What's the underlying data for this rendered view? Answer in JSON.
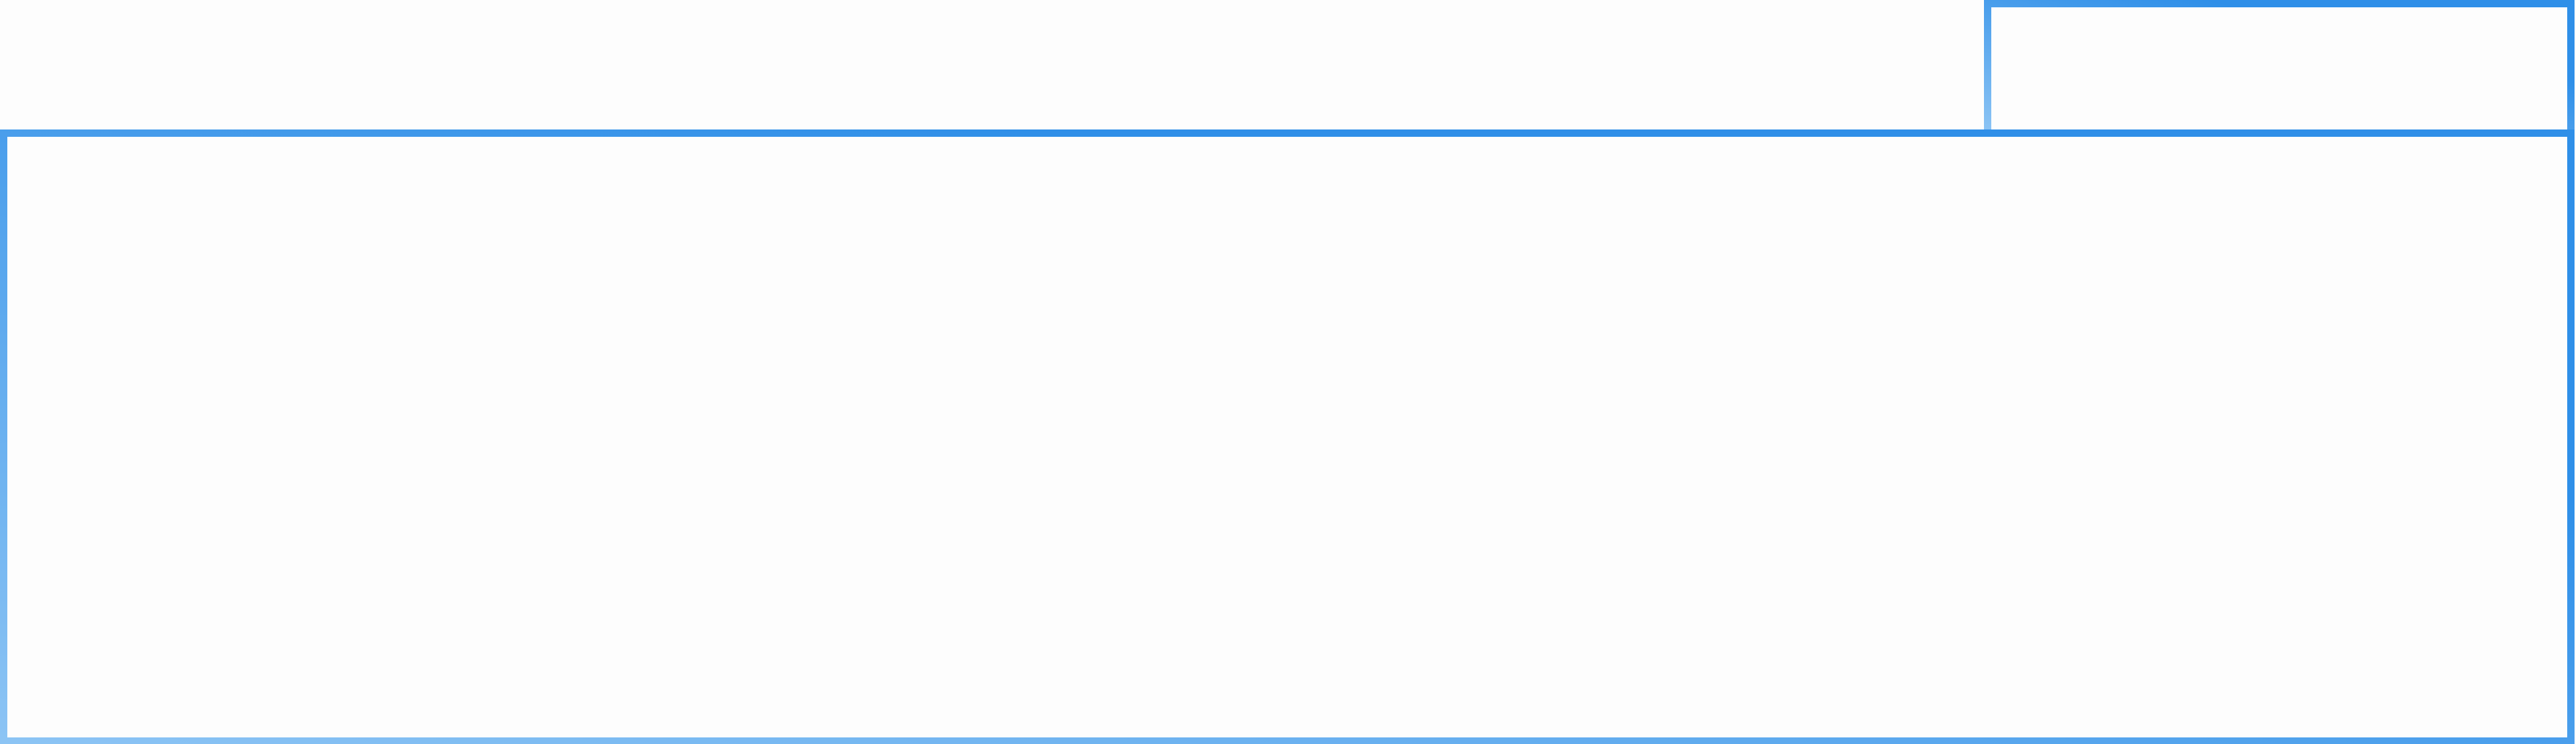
{
  "tab": {
    "label": ""
  },
  "panel": {
    "content": ""
  },
  "colors": {
    "border_light": "#8cc4f4",
    "border_dark": "#2f8fe8",
    "background": "#fdfdfd"
  }
}
